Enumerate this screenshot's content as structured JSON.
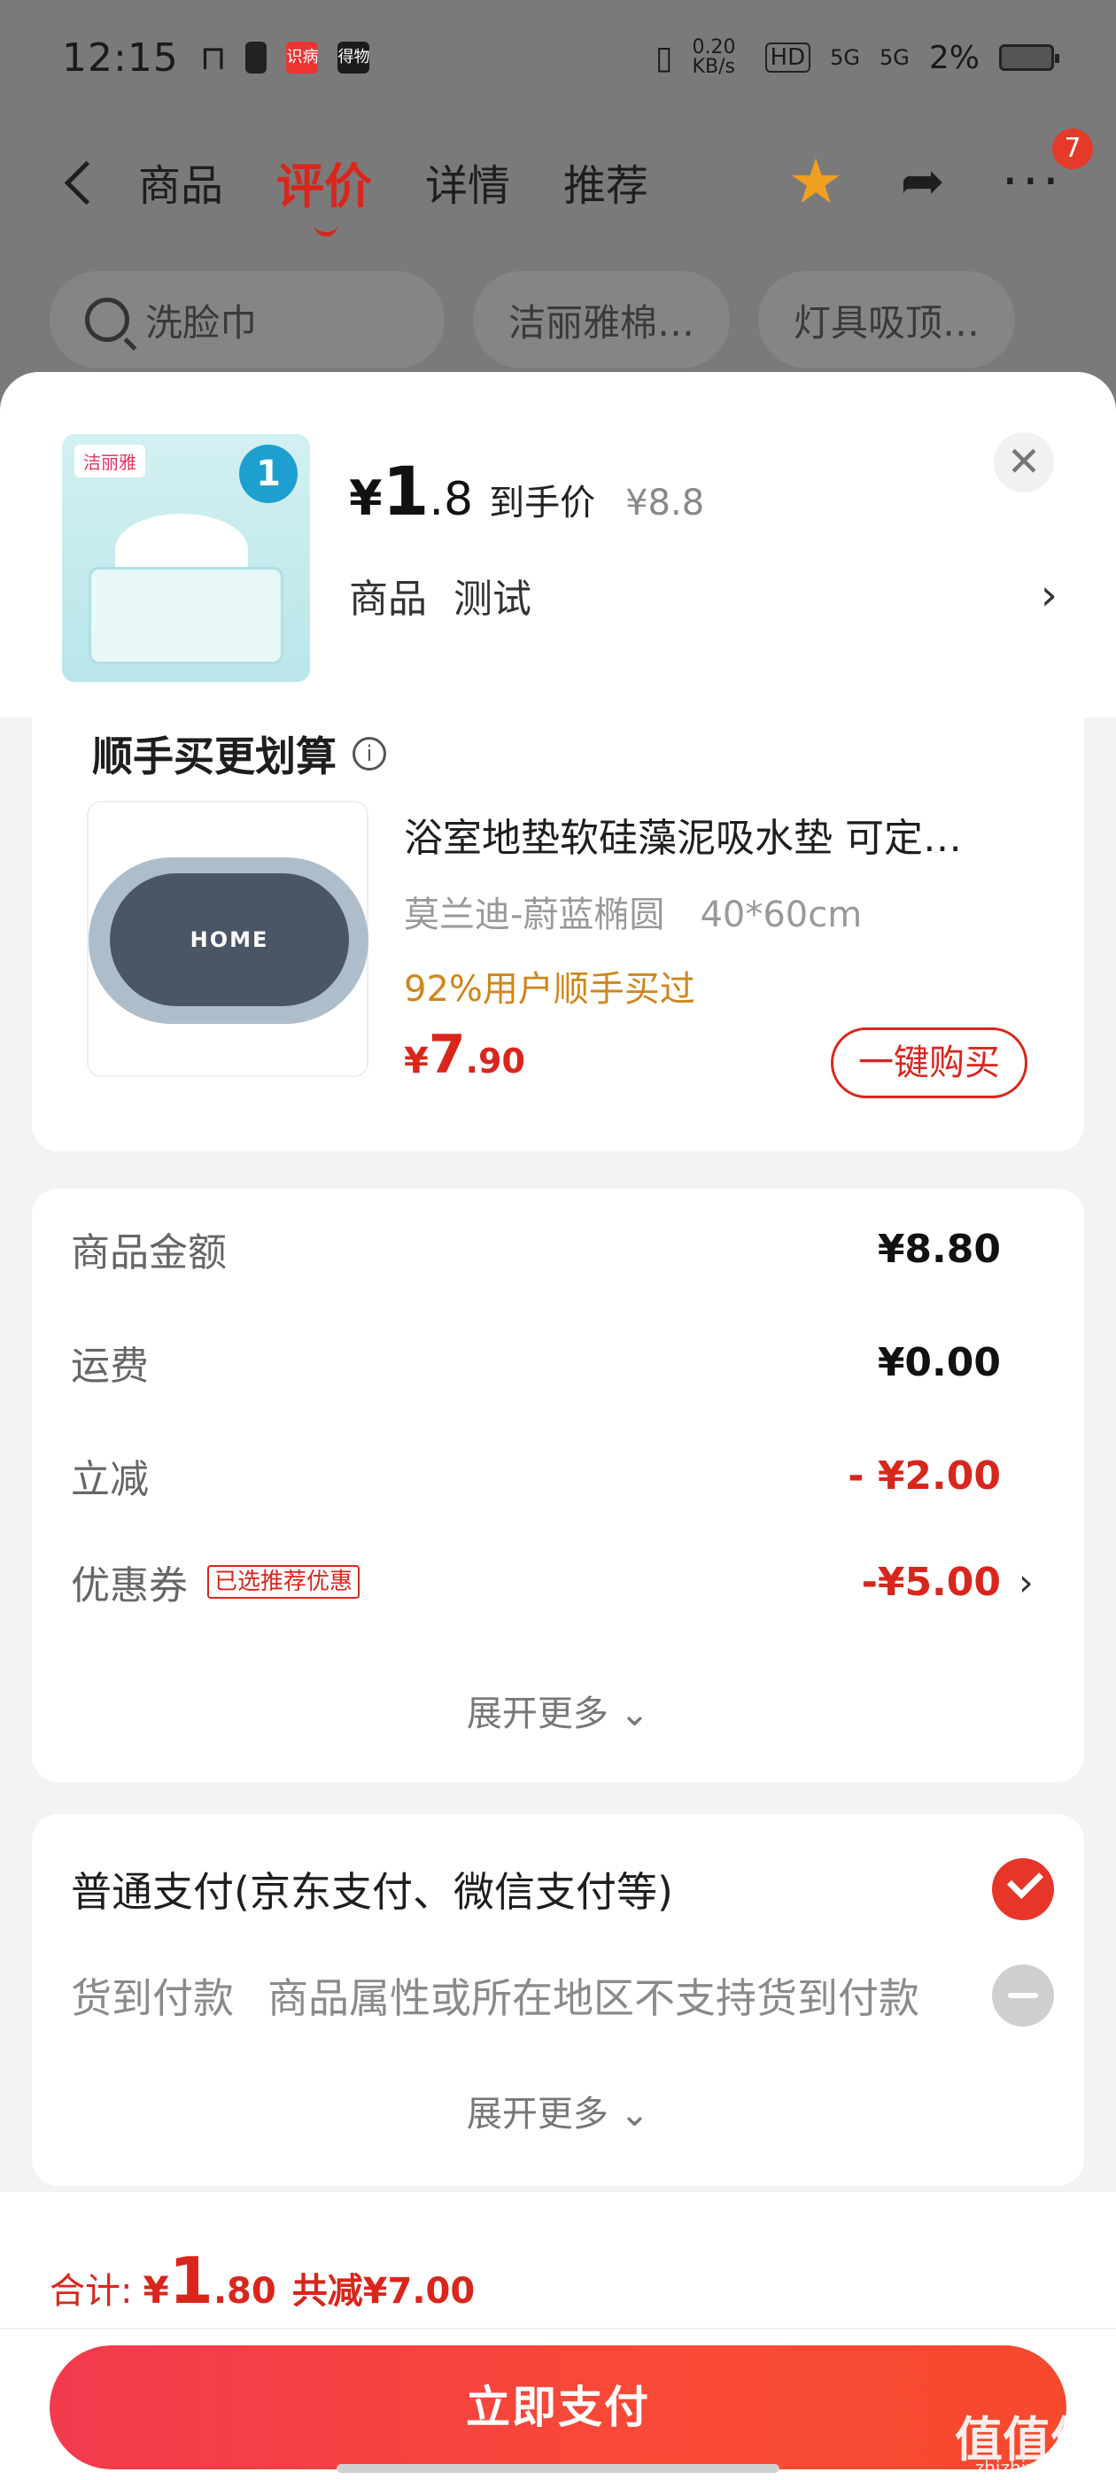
{
  "status_bar": {
    "time": "12:15",
    "left_icons": [
      "notification-icon",
      "sim-icon",
      "app-icon-red",
      "app-icon-dark"
    ],
    "app_icon_labels": [
      "识病",
      "得物"
    ],
    "net_speed": "0.20\nKB/s",
    "net_speed_text": "0.20 KB/s",
    "hd_label": "HD",
    "signal_5g_1": "5G",
    "signal_5g_2": "5G",
    "battery_pct": "2%"
  },
  "nav": {
    "tabs": [
      "商品",
      "评价",
      "详情",
      "推荐"
    ],
    "active_tab": "评价",
    "cart_badge": "7"
  },
  "search_row": {
    "main_query": "洗脸巾",
    "chip_1": "洁丽雅棉…",
    "chip_2": "灯具吸顶…"
  },
  "product": {
    "thumb_brand": "洁丽雅",
    "thumb_count": "1",
    "price_yen": "¥",
    "price_int": "1",
    "price_dec": ".8",
    "price_tag": "到手价",
    "price_orig": "¥8.8",
    "spec_label": "商品",
    "spec_value": "测试"
  },
  "upsell": {
    "title": "顺手买更划算",
    "thumb_text": "HOME",
    "name": "浴室地垫软硅藻泥吸水垫 可定…",
    "sku_color": "莫兰迪-蔚蓝椭圆",
    "sku_size": "40*60cm",
    "social_proof": "92%用户顺手买过",
    "price_yen": "¥",
    "price_int": "7",
    "price_dec": ".90",
    "buy_label": "一键购买"
  },
  "amounts": {
    "rows": [
      {
        "label": "商品金额",
        "value": "¥8.80"
      },
      {
        "label": "运费",
        "value": "¥0.00"
      },
      {
        "label": "立减",
        "value": "- ¥2.00"
      },
      {
        "label": "优惠券",
        "value": "-¥5.00",
        "badge": "已选推荐优惠"
      }
    ],
    "expand_label": "展开更多"
  },
  "payment": {
    "options": [
      {
        "label": "普通支付(京东支付、微信支付等)",
        "selected": true
      },
      {
        "label": "货到付款",
        "note": "商品属性或所在地区不支持货到付款",
        "selected": false
      }
    ],
    "expand_label": "展开更多"
  },
  "footer": {
    "total_label": "合计:",
    "total_yen": "¥",
    "total_int": "1",
    "total_dec": ".80",
    "total_saved": "共减¥7.00",
    "pay_button": "立即支付"
  },
  "watermark": {
    "text": "值值值",
    "sub": "zhizhizhi.com"
  },
  "colors": {
    "accent_red": "#d9261c",
    "social_orange": "#d0861b",
    "star_orange": "#f0a020",
    "pay_gradient_start": "#f23a4e",
    "pay_gradient_end": "#f6492e"
  }
}
